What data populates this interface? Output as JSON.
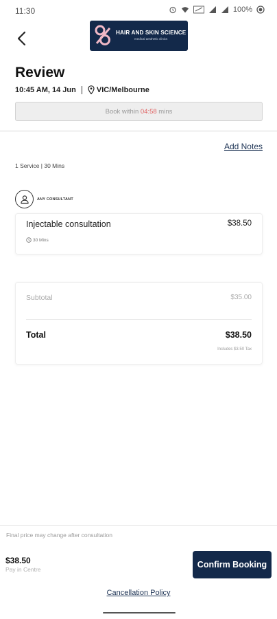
{
  "status_bar": {
    "time": "11:30",
    "battery": "100%",
    "icons": [
      "alarm-icon",
      "wifi-icon",
      "signal-icon",
      "battery-icon"
    ]
  },
  "header": {
    "back_icon": "chevron-left-icon",
    "logo": {
      "title": "HAIR AND SKIN SCIENCE",
      "subtitle": "medical aesthetic clinics",
      "background": "#13294a"
    }
  },
  "review": {
    "title": "Review",
    "datetime": "10:45 AM, 14 Jun",
    "location": "VIC/Melbourne",
    "timer_prefix": "Book within ",
    "timer_value": "04:58",
    "timer_suffix": " mins"
  },
  "notes": {
    "add_notes": "Add Notes"
  },
  "summary": {
    "text": "1 Service | 30 Mins"
  },
  "consultant": {
    "label": "ANY CONSULTANT"
  },
  "service": {
    "name": "Injectable consultation",
    "price": "$38.50",
    "duration": "30 Mins"
  },
  "totals": {
    "subtotal_label": "Subtotal",
    "subtotal_value": "$35.00",
    "total_label": "Total",
    "total_value": "$38.50",
    "tax_note": "Includes $3.50 Tax"
  },
  "footer": {
    "price_note": "Final price may change after consultation",
    "price": "$38.50",
    "pay_note": "Pay in Centre",
    "confirm_button": "Confirm Booking",
    "cancellation_policy": "Cancellation Policy"
  },
  "colors": {
    "primary": "#13294a",
    "timer_accent": "#e06464",
    "link": "#1f3556"
  }
}
